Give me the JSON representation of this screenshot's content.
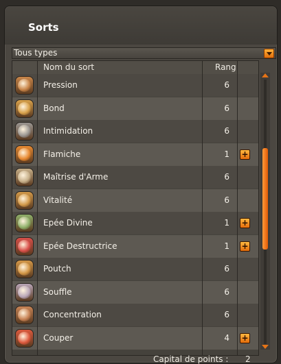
{
  "window": {
    "title": "Sorts"
  },
  "filter": {
    "selected": "Tous types",
    "icon": "chevron-down-icon"
  },
  "table": {
    "columns": {
      "name": "Nom du sort",
      "rank": "Rang"
    },
    "rows": [
      {
        "name": "Pression",
        "rank": "6",
        "upgrade": false,
        "icon": "pression-spell-icon",
        "color": "#c9864a"
      },
      {
        "name": "Bond",
        "rank": "6",
        "upgrade": false,
        "icon": "bond-spell-icon",
        "color": "#d9a24c"
      },
      {
        "name": "Intimidation",
        "rank": "6",
        "upgrade": false,
        "icon": "intimidation-spell-icon",
        "color": "#9a9692"
      },
      {
        "name": "Flamiche",
        "rank": "1",
        "upgrade": true,
        "icon": "flamiche-spell-icon",
        "color": "#e88a32"
      },
      {
        "name": "Maîtrise d'Arme",
        "rank": "6",
        "upgrade": false,
        "icon": "maitrise-arme-spell-icon",
        "color": "#c7b08a"
      },
      {
        "name": "Vitalité",
        "rank": "6",
        "upgrade": false,
        "icon": "vitalite-spell-icon",
        "color": "#d39a4a"
      },
      {
        "name": "Epée Divine",
        "rank": "1",
        "upgrade": true,
        "icon": "epee-divine-spell-icon",
        "color": "#8fb06a"
      },
      {
        "name": "Epée Destructrice",
        "rank": "1",
        "upgrade": true,
        "icon": "epee-destructrice-spell-icon",
        "color": "#d9504a"
      },
      {
        "name": "Poutch",
        "rank": "6",
        "upgrade": false,
        "icon": "poutch-spell-icon",
        "color": "#d49848"
      },
      {
        "name": "Souffle",
        "rank": "6",
        "upgrade": false,
        "icon": "souffle-spell-icon",
        "color": "#b9a6b8"
      },
      {
        "name": "Concentration",
        "rank": "6",
        "upgrade": false,
        "icon": "concentration-spell-icon",
        "color": "#c88456"
      },
      {
        "name": "Couper",
        "rank": "4",
        "upgrade": true,
        "icon": "couper-spell-icon",
        "color": "#dd5a3e"
      }
    ]
  },
  "footer": {
    "capital_label": "Capital de points :",
    "capital_value": "2"
  },
  "plus_glyph": "+"
}
